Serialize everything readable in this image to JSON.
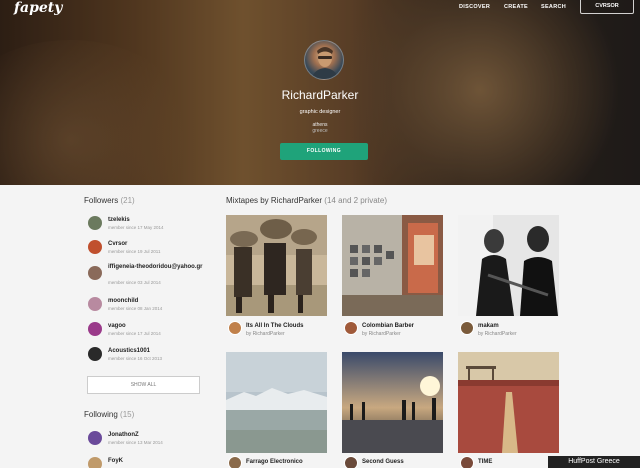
{
  "header": {
    "logo": "fapety",
    "nav": [
      "DISCOVER",
      "CREATE",
      "SEARCH"
    ],
    "login_label": "CVRSOR"
  },
  "profile": {
    "name": "RichardParker",
    "role": "graphic designer",
    "city": "athens",
    "country": "greece",
    "follow_label": "FOLLOWING"
  },
  "followers": {
    "title": "Followers",
    "count": "(21)",
    "items": [
      {
        "name": "tzelekis",
        "since": "member since 17 May 2014",
        "color": "#6b7a5e"
      },
      {
        "name": "Cvrsor",
        "since": "member since 19 Jul 2011",
        "color": "#c0502e"
      },
      {
        "name": "iffigeneia-theodoridou@yahoo.gr",
        "since": "member since 03 Jul 2014",
        "color": "#8a6a5a"
      },
      {
        "name": "moonchild",
        "since": "member since 08 Jan 2014",
        "color": "#b88aa0"
      },
      {
        "name": "vagoo",
        "since": "member since 17 Jul 2014",
        "color": "#9a3a8a"
      },
      {
        "name": "Acoustics1001",
        "since": "member since 16 Oct 2013",
        "color": "#2a2a2a"
      }
    ],
    "show_all_label": "SHOW ALL"
  },
  "following": {
    "title": "Following",
    "count": "(15)",
    "items": [
      {
        "name": "JonathonZ",
        "since": "member since 13 Mar 2014",
        "color": "#6a4a9a"
      },
      {
        "name": "FoyK",
        "since": "",
        "color": "#c09a6a"
      }
    ]
  },
  "mixtapes": {
    "title": "Mixtapes by RichardParker",
    "count": "(14 and 2 private)",
    "items": [
      {
        "title": "Its All In The Clouds",
        "by": "by RichardParker"
      },
      {
        "title": "Colombian Barber",
        "by": "by RichardParker"
      },
      {
        "title": "makam",
        "by": "by RichardParker"
      },
      {
        "title": "Farrago Electronico",
        "by": ""
      },
      {
        "title": "Second Guess",
        "by": ""
      },
      {
        "title": "TIME",
        "by": ""
      }
    ]
  },
  "watermark": "HuffPost Greece"
}
